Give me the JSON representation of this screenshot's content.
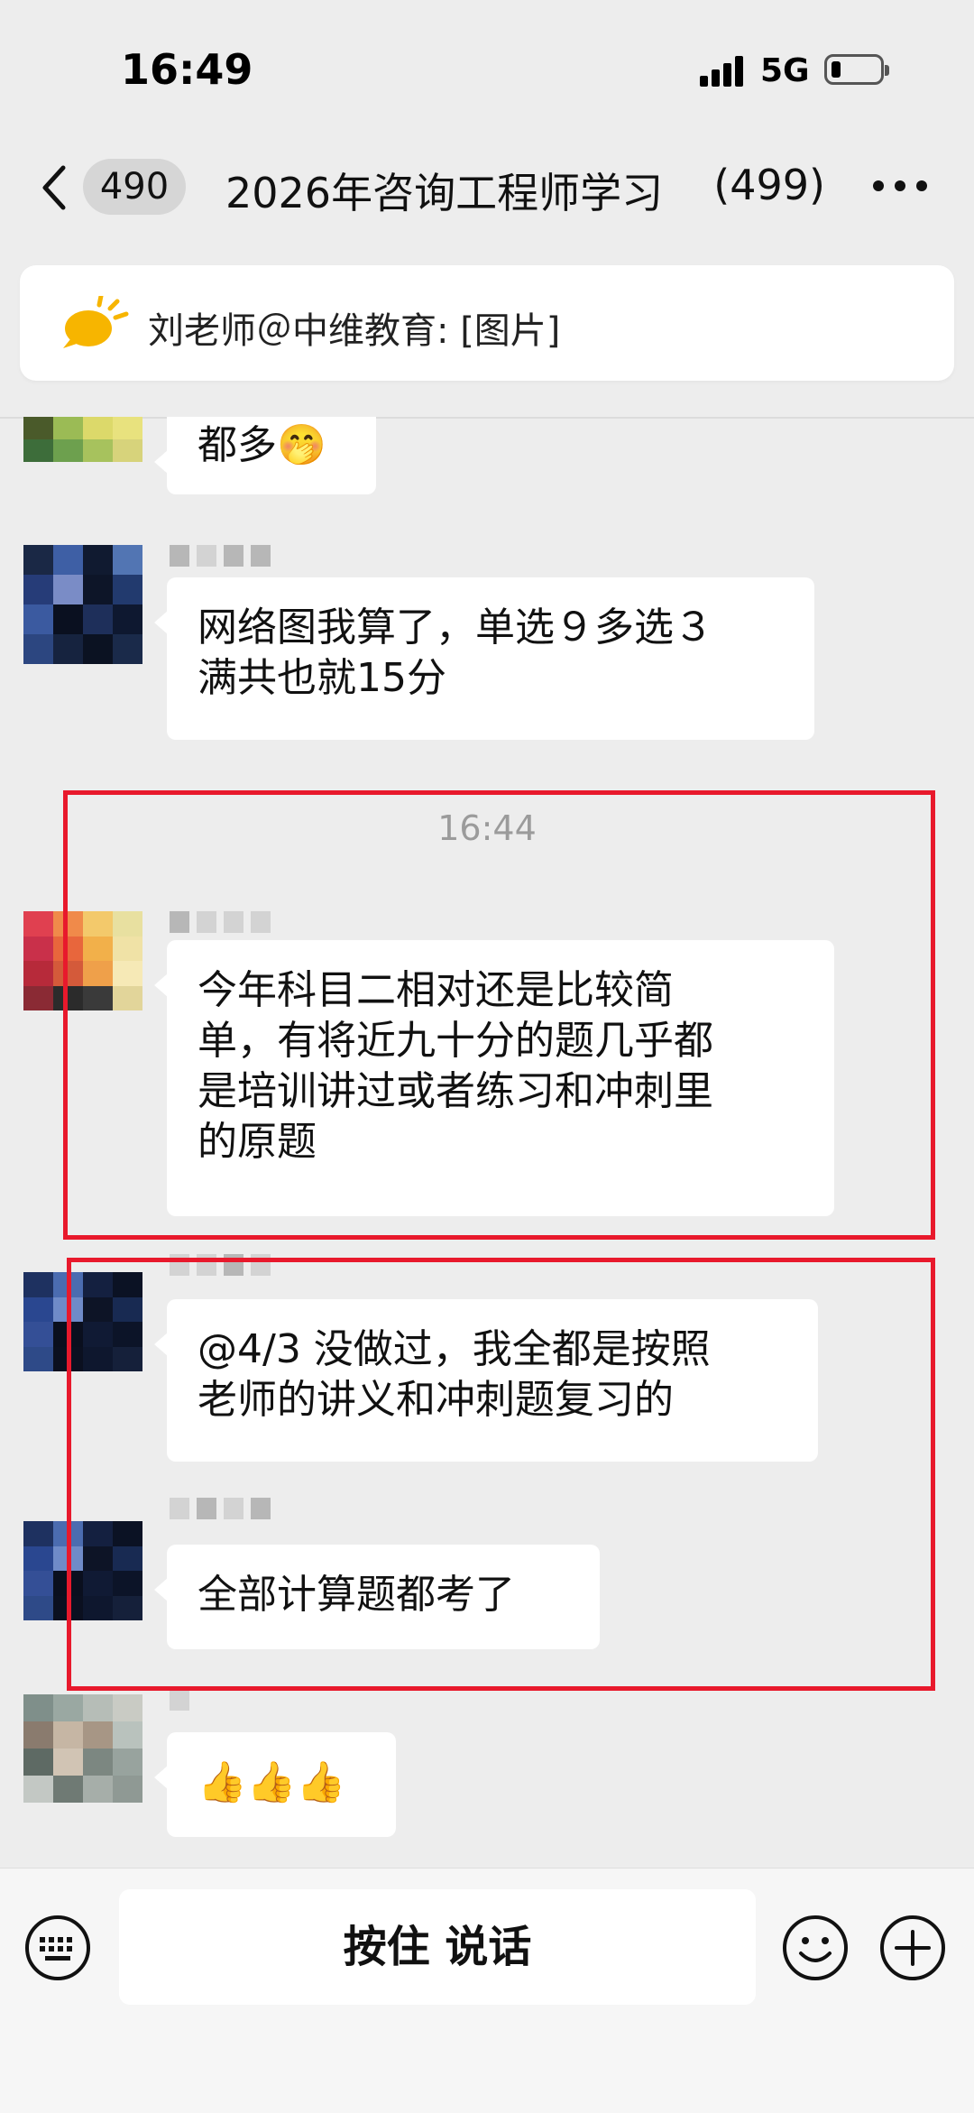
{
  "status_bar": {
    "time": "16:49",
    "network": "5G"
  },
  "nav": {
    "unread_badge": "490",
    "title": "2026年咨询工程师学习",
    "member_count": "(499)"
  },
  "pinned": {
    "text": "刘老师＠中维教育: [图片]"
  },
  "messages": [
    {
      "text": "都多🤭"
    },
    {
      "text": "网络图我算了，单选９多选３\n满共也就15分"
    },
    {
      "text": "今年科目二相对还是比较简\n单，有将近九十分的题几乎都\n是培训讲过或者练习和冲刺里\n的原题"
    },
    {
      "text": "@4/3 没做过，我全都是按照\n老师的讲义和冲刺题复习的"
    },
    {
      "text": "全部计算题都考了"
    },
    {
      "text": "👍👍👍"
    }
  ],
  "time_separator": "16:44",
  "input": {
    "talk_label": "按住 说话"
  },
  "colors": {
    "background": "#ededed",
    "bubble": "#ffffff",
    "highlight_box": "#e8192c"
  }
}
